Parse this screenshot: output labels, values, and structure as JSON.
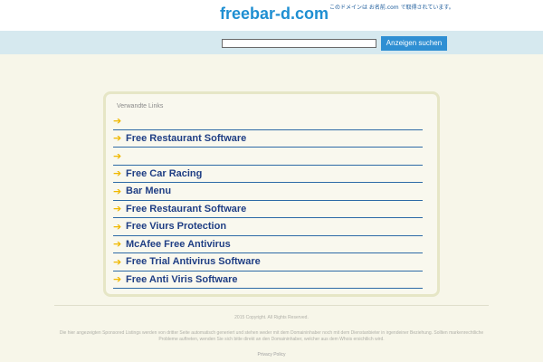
{
  "header": {
    "site_title": "freebar-d.com",
    "registration_note": "このドメインは お名前.com で取得されています。"
  },
  "search": {
    "value": "",
    "placeholder": "",
    "button_label": "Anzeigen suchen"
  },
  "links": {
    "header": "Verwandte Links",
    "items": [
      {
        "label": ""
      },
      {
        "label": "Free Restaurant Software"
      },
      {
        "label": ""
      },
      {
        "label": "Free Car Racing"
      },
      {
        "label": "Bar Menu"
      },
      {
        "label": "Free Restaurant Software"
      },
      {
        "label": "Free Viurs Protection"
      },
      {
        "label": "McAfee Free Antivirus"
      },
      {
        "label": "Free Trial Antivirus Software"
      },
      {
        "label": "Free Anti Viris Software"
      }
    ],
    "arrow_glyph": "➔",
    "arrow_color": "#f0b800",
    "link_color": "#1f3e84"
  },
  "footer": {
    "copyright": "2015 Copyright. All Rights Reserved.",
    "disclaimer": "Die hier angezeigten Sponsored Listings werden von dritter Seite automatisch generiert und stehen weder mit dem Domaininhaber noch mit dem Dienstanbieter in irgendeiner Beziehung. Sollten markenrechtliche Probleme auftreten, wenden Sie sich bitte direkt an den Domaininhaber, welcher aus dem Whois ersichtlich wird.",
    "privacy_label": "Privacy Policy"
  },
  "colors": {
    "accent": "#1f8fd2",
    "search_bar_bg": "#d6e9ef",
    "page_bg": "#f7f6e9"
  }
}
